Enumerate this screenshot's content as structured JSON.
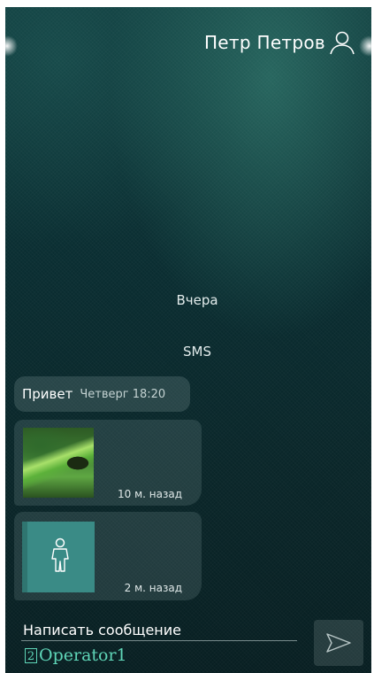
{
  "header": {
    "user_name": "Петр Петров",
    "user_icon": "user-icon"
  },
  "separators": {
    "yesterday": "Вчера",
    "channel": "SMS"
  },
  "messages": [
    {
      "text": "Привет",
      "time": "Четверг 18:20"
    },
    {
      "type": "photo",
      "ago": "10 м. назад"
    },
    {
      "type": "contact",
      "ago": "2 м. назад",
      "icon": "person-icon"
    }
  ],
  "composer": {
    "label": "Написать сообщение",
    "send_icon": "send-icon"
  },
  "operator": {
    "badge": "2",
    "name": "Operator1"
  },
  "colors": {
    "accent": "#5fd6b8",
    "contact_tile": "#3a8b86"
  }
}
